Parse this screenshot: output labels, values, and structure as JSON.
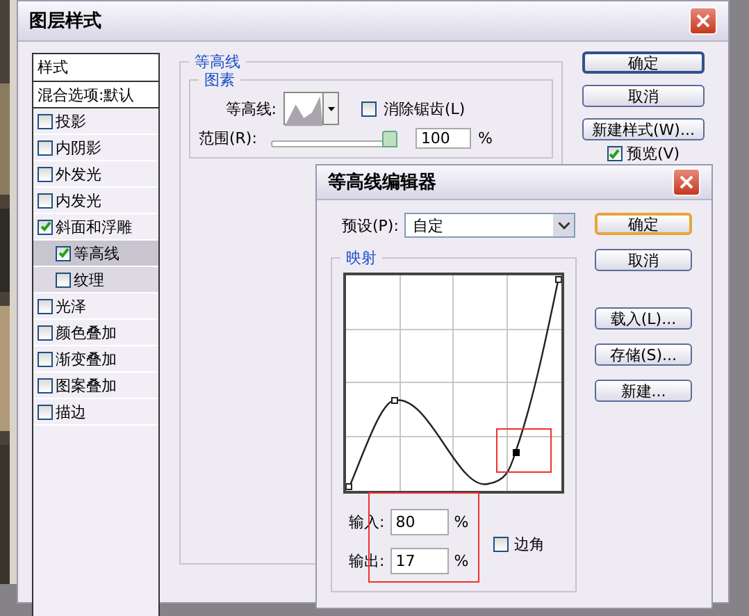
{
  "main_dialog": {
    "title": "图层样式",
    "styles_list": {
      "header": "样式",
      "items": [
        {
          "label": "混合选项:默认",
          "kind": "plain",
          "selected": false
        },
        {
          "label": "投影",
          "kind": "check",
          "checked": false,
          "selected": false
        },
        {
          "label": "内阴影",
          "kind": "check",
          "checked": false,
          "selected": false
        },
        {
          "label": "外发光",
          "kind": "check",
          "checked": false,
          "selected": false
        },
        {
          "label": "内发光",
          "kind": "check",
          "checked": false,
          "selected": false
        },
        {
          "label": "斜面和浮雕",
          "kind": "check",
          "checked": true,
          "selected": false,
          "children": [
            {
              "label": "等高线",
              "kind": "check",
              "checked": true,
              "selected": true
            },
            {
              "label": "纹理",
              "kind": "check",
              "checked": false,
              "selected": false
            }
          ]
        },
        {
          "label": "光泽",
          "kind": "check",
          "checked": false,
          "selected": false
        },
        {
          "label": "颜色叠加",
          "kind": "check",
          "checked": false,
          "selected": false
        },
        {
          "label": "渐变叠加",
          "kind": "check",
          "checked": false,
          "selected": false
        },
        {
          "label": "图案叠加",
          "kind": "check",
          "checked": false,
          "selected": false
        },
        {
          "label": "描边",
          "kind": "check",
          "checked": false,
          "selected": false
        }
      ]
    },
    "contour_section": {
      "title": "等高线",
      "group_title": "图素",
      "contour_label": "等高线:",
      "antialias": {
        "label": "消除锯齿(L)",
        "checked": false
      },
      "range": {
        "label": "范围(R):",
        "level": 1.0,
        "value": "100",
        "unit": "%"
      }
    },
    "buttons": [
      {
        "label": "确定",
        "default": true
      },
      {
        "label": "取消",
        "default": false
      },
      {
        "label": "新建样式(W)...",
        "default": false
      }
    ],
    "preview": {
      "label": "预览(V)",
      "checked": true
    }
  },
  "contour_editor": {
    "title": "等高线编辑器",
    "preset": {
      "label": "预设(P):",
      "value": "自定"
    },
    "buttons": [
      {
        "label": "确定",
        "default": true
      },
      {
        "label": "取消",
        "default": false
      },
      {
        "label": "载入(L)...",
        "default": false
      },
      {
        "label": "存储(S)...",
        "default": false
      },
      {
        "label": "新建...",
        "default": false
      }
    ],
    "mapping_title": "映射",
    "input": {
      "label": "输入:",
      "value": "80",
      "unit": "%"
    },
    "output": {
      "label": "输出:",
      "value": "17",
      "unit": "%"
    },
    "corner": {
      "label": "边角",
      "checked": false
    }
  }
}
